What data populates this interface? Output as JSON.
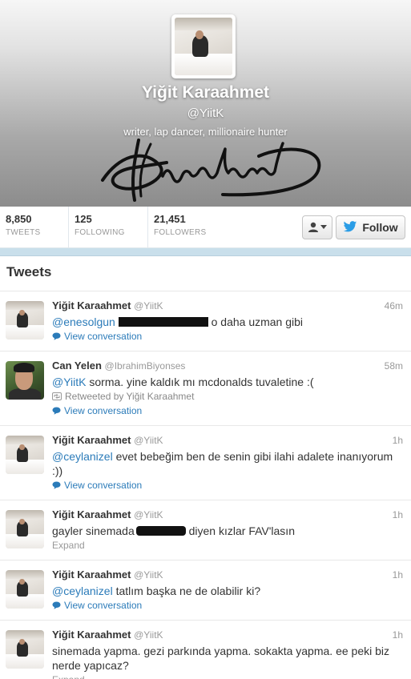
{
  "profile": {
    "name": "Yiğit Karaahmet",
    "handle": "@YiitK",
    "bio": "writer, lap dancer, millionaire hunter"
  },
  "stats": [
    {
      "value": "8,850",
      "label": "TWEETS"
    },
    {
      "value": "125",
      "label": "FOLLOWING"
    },
    {
      "value": "21,451",
      "label": "FOLLOWERS"
    }
  ],
  "actions": {
    "follow_label": "Follow"
  },
  "tweets_heading": "Tweets",
  "tweets": [
    {
      "name": "Yiğit Karaahmet",
      "handle": "@YiitK",
      "time": "46m",
      "mention": "@enesolgun",
      "text_after": "o daha uzman gibi",
      "link": "View conversation"
    },
    {
      "name": "Can Yelen",
      "handle": "@IbrahimBiyonses",
      "time": "58m",
      "mention": "@YiitK",
      "text": "sorma. yine kaldık mı mcdonalds tuvaletine :(",
      "retweeted_by": "Retweeted by Yiğit Karaahmet",
      "link": "View conversation"
    },
    {
      "name": "Yiğit Karaahmet",
      "handle": "@YiitK",
      "time": "1h",
      "mention": "@ceylanizel",
      "text": "evet bebeğim ben de senin gibi ilahi adalete inanıyorum :))",
      "link": "View conversation"
    },
    {
      "name": "Yiğit Karaahmet",
      "handle": "@YiitK",
      "time": "1h",
      "text_before": "gayler sinemada",
      "text_after": "diyen kızlar FAV'lasın",
      "expand": "Expand"
    },
    {
      "name": "Yiğit Karaahmet",
      "handle": "@YiitK",
      "time": "1h",
      "mention": "@ceylanizel",
      "text": "tatlım başka ne de olabilir ki?",
      "link": "View conversation"
    },
    {
      "name": "Yiğit Karaahmet",
      "handle": "@YiitK",
      "time": "1h",
      "text": "sinemada yapma. gezi parkında yapma. sokakta yapma. ee peki biz nerde yapıcaz?",
      "expand": "Expand"
    }
  ]
}
